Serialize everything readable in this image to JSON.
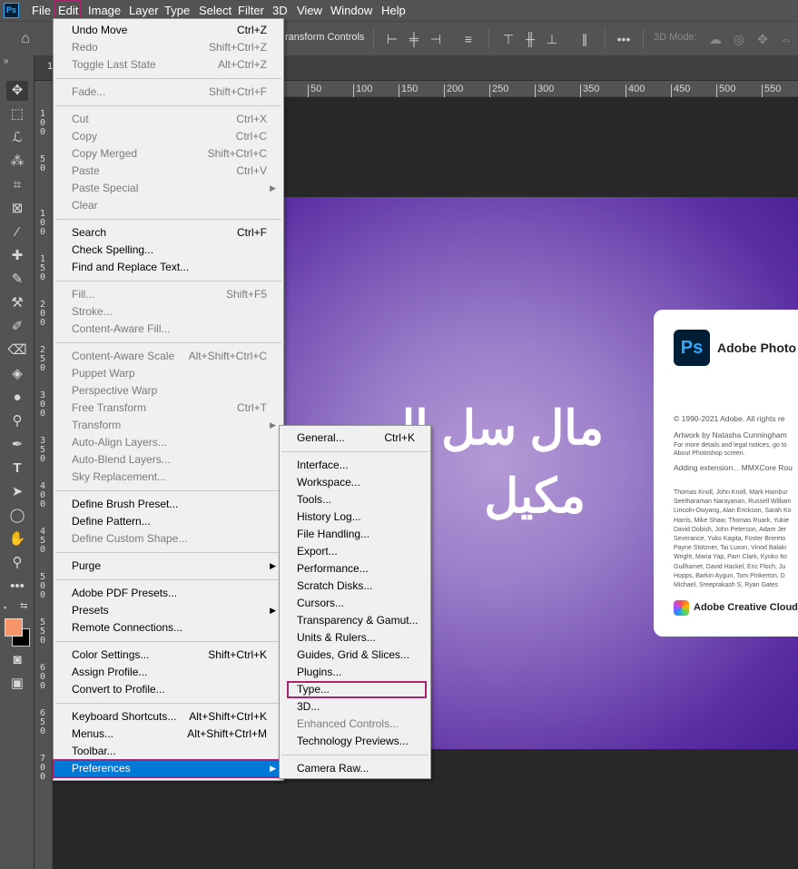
{
  "app": {
    "logo": "Ps"
  },
  "menubar": [
    "File",
    "Edit",
    "Image",
    "Layer",
    "Type",
    "Select",
    "Filter",
    "3D",
    "View",
    "Window",
    "Help"
  ],
  "options_bar": {
    "transform_controls": "ransform Controls",
    "mode_3d": "3D Mode:"
  },
  "document_tab": {
    "label": "1"
  },
  "ruler_h": [
    "50",
    "100",
    "150",
    "200",
    "250",
    "300",
    "350",
    "400",
    "450",
    "500",
    "550"
  ],
  "ruler_v": [
    [
      "1",
      "0",
      "0"
    ],
    [
      "5",
      "0"
    ],
    [
      "1",
      "0",
      "0"
    ],
    [
      "1",
      "5",
      "0"
    ],
    [
      "2",
      "0",
      "0"
    ],
    [
      "2",
      "5",
      "0"
    ],
    [
      "3",
      "0",
      "0"
    ],
    [
      "3",
      "5",
      "0"
    ],
    [
      "4",
      "0",
      "0"
    ],
    [
      "4",
      "5",
      "0"
    ],
    [
      "5",
      "0",
      "0"
    ],
    [
      "5",
      "5",
      "0"
    ],
    [
      "6",
      "0",
      "0"
    ],
    [
      "6",
      "5",
      "0"
    ],
    [
      "7",
      "0",
      "0"
    ]
  ],
  "canvas": {
    "arabic_line1": "مال سل اا",
    "arabic_line2": "مكيل"
  },
  "splash": {
    "logo": "Ps",
    "title": "Adobe Photo",
    "copyright": "© 1990-2021 Adobe. All rights re",
    "artwork1": "Artwork by Natasha Cunningham",
    "artwork2": "For more details and legal notices, go to",
    "artwork3": "About Photoshop screen.",
    "adding": "Adding extension... MMXCore Rou",
    "credits": "Thomas Knoll, John Knoll, Mark Hambur\nSeetharaman Narayanan, Russell William\nLincoln-Owyang, Alan Erickson, Sarah Ko\nHarris, Mike Shaw, Thomas Ruark, Yukie\nDavid Dobish, John Peterson, Adam Jer\nSeverance, Yuko Kagita, Foster Brereto\nPayne Stotzner, Tai Luxon, Vinod Balakr\nWright, Maria Yap, Pam Clark, Kyoko Ito\nGuilhamet, David Hackel, Eric Floch, Ju\nHopps, Barkin Aygun, Tom Pinkerton, D\nMichael, Sreeprakash S, Ryan Gates",
    "cc": "Adobe Creative Cloud"
  },
  "edit_menu": [
    {
      "label": "Undo Move",
      "shortcut": "Ctrl+Z",
      "enabled": true
    },
    {
      "label": "Redo",
      "shortcut": "Shift+Ctrl+Z",
      "enabled": false
    },
    {
      "label": "Toggle Last State",
      "shortcut": "Alt+Ctrl+Z",
      "enabled": false
    },
    {
      "sep": true
    },
    {
      "label": "Fade...",
      "shortcut": "Shift+Ctrl+F",
      "enabled": false
    },
    {
      "sep": true
    },
    {
      "label": "Cut",
      "shortcut": "Ctrl+X",
      "enabled": false
    },
    {
      "label": "Copy",
      "shortcut": "Ctrl+C",
      "enabled": false
    },
    {
      "label": "Copy Merged",
      "shortcut": "Shift+Ctrl+C",
      "enabled": false
    },
    {
      "label": "Paste",
      "shortcut": "Ctrl+V",
      "enabled": false
    },
    {
      "label": "Paste Special",
      "submenu": true,
      "enabled": false
    },
    {
      "label": "Clear",
      "enabled": false
    },
    {
      "sep": true
    },
    {
      "label": "Search",
      "shortcut": "Ctrl+F",
      "enabled": true
    },
    {
      "label": "Check Spelling...",
      "enabled": true
    },
    {
      "label": "Find and Replace Text...",
      "enabled": true
    },
    {
      "sep": true
    },
    {
      "label": "Fill...",
      "shortcut": "Shift+F5",
      "enabled": false
    },
    {
      "label": "Stroke...",
      "enabled": false
    },
    {
      "label": "Content-Aware Fill...",
      "enabled": false
    },
    {
      "sep": true
    },
    {
      "label": "Content-Aware Scale",
      "shortcut": "Alt+Shift+Ctrl+C",
      "enabled": false
    },
    {
      "label": "Puppet Warp",
      "enabled": false
    },
    {
      "label": "Perspective Warp",
      "enabled": false
    },
    {
      "label": "Free Transform",
      "shortcut": "Ctrl+T",
      "enabled": false
    },
    {
      "label": "Transform",
      "submenu": true,
      "enabled": false
    },
    {
      "label": "Auto-Align Layers...",
      "enabled": false
    },
    {
      "label": "Auto-Blend Layers...",
      "enabled": false
    },
    {
      "label": "Sky Replacement...",
      "enabled": false
    },
    {
      "sep": true
    },
    {
      "label": "Define Brush Preset...",
      "enabled": true
    },
    {
      "label": "Define Pattern...",
      "enabled": true
    },
    {
      "label": "Define Custom Shape...",
      "enabled": false
    },
    {
      "sep": true
    },
    {
      "label": "Purge",
      "submenu": true,
      "enabled": true
    },
    {
      "sep": true
    },
    {
      "label": "Adobe PDF Presets...",
      "enabled": true
    },
    {
      "label": "Presets",
      "submenu": true,
      "enabled": true
    },
    {
      "label": "Remote Connections...",
      "enabled": true
    },
    {
      "sep": true
    },
    {
      "label": "Color Settings...",
      "shortcut": "Shift+Ctrl+K",
      "enabled": true
    },
    {
      "label": "Assign Profile...",
      "enabled": true
    },
    {
      "label": "Convert to Profile...",
      "enabled": true
    },
    {
      "sep": true
    },
    {
      "label": "Keyboard Shortcuts...",
      "shortcut": "Alt+Shift+Ctrl+K",
      "enabled": true
    },
    {
      "label": "Menus...",
      "shortcut": "Alt+Shift+Ctrl+M",
      "enabled": true
    },
    {
      "label": "Toolbar...",
      "enabled": true
    },
    {
      "label": "Preferences",
      "submenu": true,
      "enabled": true,
      "highlighted": true
    }
  ],
  "preferences_menu": [
    {
      "label": "General...",
      "shortcut": "Ctrl+K",
      "enabled": true
    },
    {
      "sep": true
    },
    {
      "label": "Interface...",
      "enabled": true
    },
    {
      "label": "Workspace...",
      "enabled": true
    },
    {
      "label": "Tools...",
      "enabled": true
    },
    {
      "label": "History Log...",
      "enabled": true
    },
    {
      "label": "File Handling...",
      "enabled": true
    },
    {
      "label": "Export...",
      "enabled": true
    },
    {
      "label": "Performance...",
      "enabled": true
    },
    {
      "label": "Scratch Disks...",
      "enabled": true
    },
    {
      "label": "Cursors...",
      "enabled": true
    },
    {
      "label": "Transparency & Gamut...",
      "enabled": true
    },
    {
      "label": "Units & Rulers...",
      "enabled": true
    },
    {
      "label": "Guides, Grid & Slices...",
      "enabled": true
    },
    {
      "label": "Plugins...",
      "enabled": true
    },
    {
      "label": "Type...",
      "enabled": true,
      "boxed": true
    },
    {
      "label": "3D...",
      "enabled": true
    },
    {
      "label": "Enhanced Controls...",
      "enabled": false
    },
    {
      "label": "Technology Previews...",
      "enabled": true
    },
    {
      "sep": true
    },
    {
      "label": "Camera Raw...",
      "enabled": true
    }
  ],
  "colors": {
    "foreground": "#f4956a",
    "background": "#000000",
    "highlight": "#0078d7",
    "annotation": "#a6266e"
  }
}
